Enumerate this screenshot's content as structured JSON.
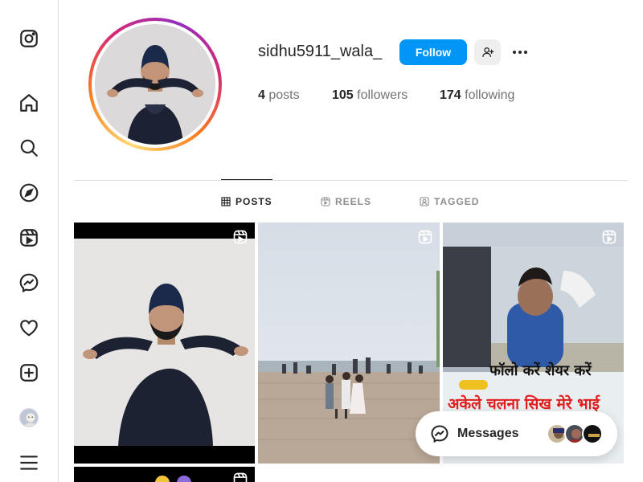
{
  "sidebar": {
    "items": [
      {
        "name": "instagram-logo",
        "icon": "instagram-icon"
      },
      {
        "name": "home",
        "icon": "home-icon"
      },
      {
        "name": "search",
        "icon": "search-icon"
      },
      {
        "name": "explore",
        "icon": "compass-icon"
      },
      {
        "name": "reels",
        "icon": "reels-icon"
      },
      {
        "name": "messages",
        "icon": "messenger-icon"
      },
      {
        "name": "notifications",
        "icon": "heart-icon"
      },
      {
        "name": "create",
        "icon": "plus-square-icon"
      },
      {
        "name": "profile",
        "icon": "avatar"
      },
      {
        "name": "more",
        "icon": "menu-icon"
      }
    ]
  },
  "profile": {
    "username": "sidhu5911_wala_",
    "follow_label": "Follow",
    "stats": {
      "posts_count": "4",
      "posts_label": "posts",
      "followers_count": "105",
      "followers_label": "followers",
      "following_count": "174",
      "following_label": "following"
    }
  },
  "tabs": [
    {
      "label": "POSTS",
      "icon": "grid-icon",
      "active": true
    },
    {
      "label": "REELS",
      "icon": "reels-icon",
      "active": false
    },
    {
      "label": "TAGGED",
      "icon": "tag-icon",
      "active": false
    }
  ],
  "posts": [
    {
      "type": "reel",
      "caption": ""
    },
    {
      "type": "reel",
      "caption": ""
    },
    {
      "type": "reel",
      "caption_line1": "फॉलो करें शेयर करें",
      "caption_line2": "अकेले चलना सिख मेरे भाई"
    },
    {
      "type": "reel",
      "caption": ""
    }
  ],
  "messages_bar": {
    "label": "Messages",
    "icon": "messenger-icon"
  },
  "colors": {
    "accent": "#0095f6",
    "text": "#262626",
    "muted": "#737373",
    "border": "#dbdbdb"
  }
}
